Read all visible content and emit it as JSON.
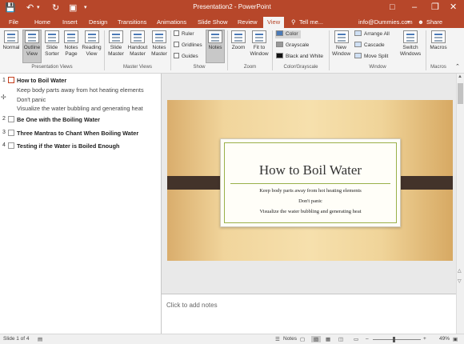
{
  "window": {
    "title": "Presentation2 - PowerPoint"
  },
  "tabs": [
    "File",
    "Home",
    "Insert",
    "Design",
    "Transitions",
    "Animations",
    "Slide Show",
    "Review",
    "View"
  ],
  "tell_me": "Tell me...",
  "account": "info@Dummies.com",
  "share": "Share",
  "ribbon": {
    "presentation_views": {
      "label": "Presentation Views",
      "normal": "Normal",
      "outline_view": "Outline View",
      "slide_sorter": "Slide Sorter",
      "notes_page": "Notes Page",
      "reading_view": "Reading View"
    },
    "master_views": {
      "label": "Master Views",
      "slide_master": "Slide Master",
      "handout_master": "Handout Master",
      "notes_master": "Notes Master"
    },
    "show": {
      "label": "Show",
      "ruler": "Ruler",
      "gridlines": "Gridlines",
      "guides": "Guides",
      "notes": "Notes"
    },
    "zoom": {
      "label": "Zoom",
      "zoom": "Zoom",
      "fit_to_window": "Fit to Window"
    },
    "color": {
      "label": "Color/Grayscale",
      "color": "Color",
      "grayscale": "Grayscale",
      "black_and_white": "Black and White"
    },
    "window": {
      "label": "Window",
      "new_window": "New Window",
      "arrange_all": "Arrange All",
      "cascade": "Cascade",
      "move_split": "Move Split",
      "switch_windows": "Switch Windows"
    },
    "macros": {
      "label": "Macros",
      "macros": "Macros"
    }
  },
  "outline": {
    "slides": [
      {
        "num": "1",
        "title": "How to Boil Water",
        "bullets": [
          "Keep body parts away from hot heating elements",
          "Don't panic",
          "Visualize the water bubbling and generating heat"
        ]
      },
      {
        "num": "2",
        "title": "Be One with the Boiling Water"
      },
      {
        "num": "3",
        "title": "Three Mantras to Chant When Boiling Water"
      },
      {
        "num": "4",
        "title": "Testing if the Water is Boiled Enough"
      }
    ]
  },
  "slide": {
    "title": "How to Boil Water",
    "bullets": [
      "Keep body parts away from hot heating elements",
      "Don't panic",
      "Visualize the water bubbling and generating heat"
    ]
  },
  "notes_placeholder": "Click to add notes",
  "status": {
    "slide_info": "Slide 1 of 4",
    "notes": "Notes",
    "zoom": "49%"
  },
  "colors": {
    "accent": "#b7472a",
    "slide_band": "#43332a",
    "slide_rule": "#9ab04a"
  },
  "icons": [
    "save-icon",
    "undo-icon",
    "redo-icon",
    "start-slideshow-icon",
    "customize-icon",
    "lightbulb-icon",
    "share-icon",
    "minimize-icon",
    "restore-icon",
    "close-icon",
    "comment-icon"
  ]
}
